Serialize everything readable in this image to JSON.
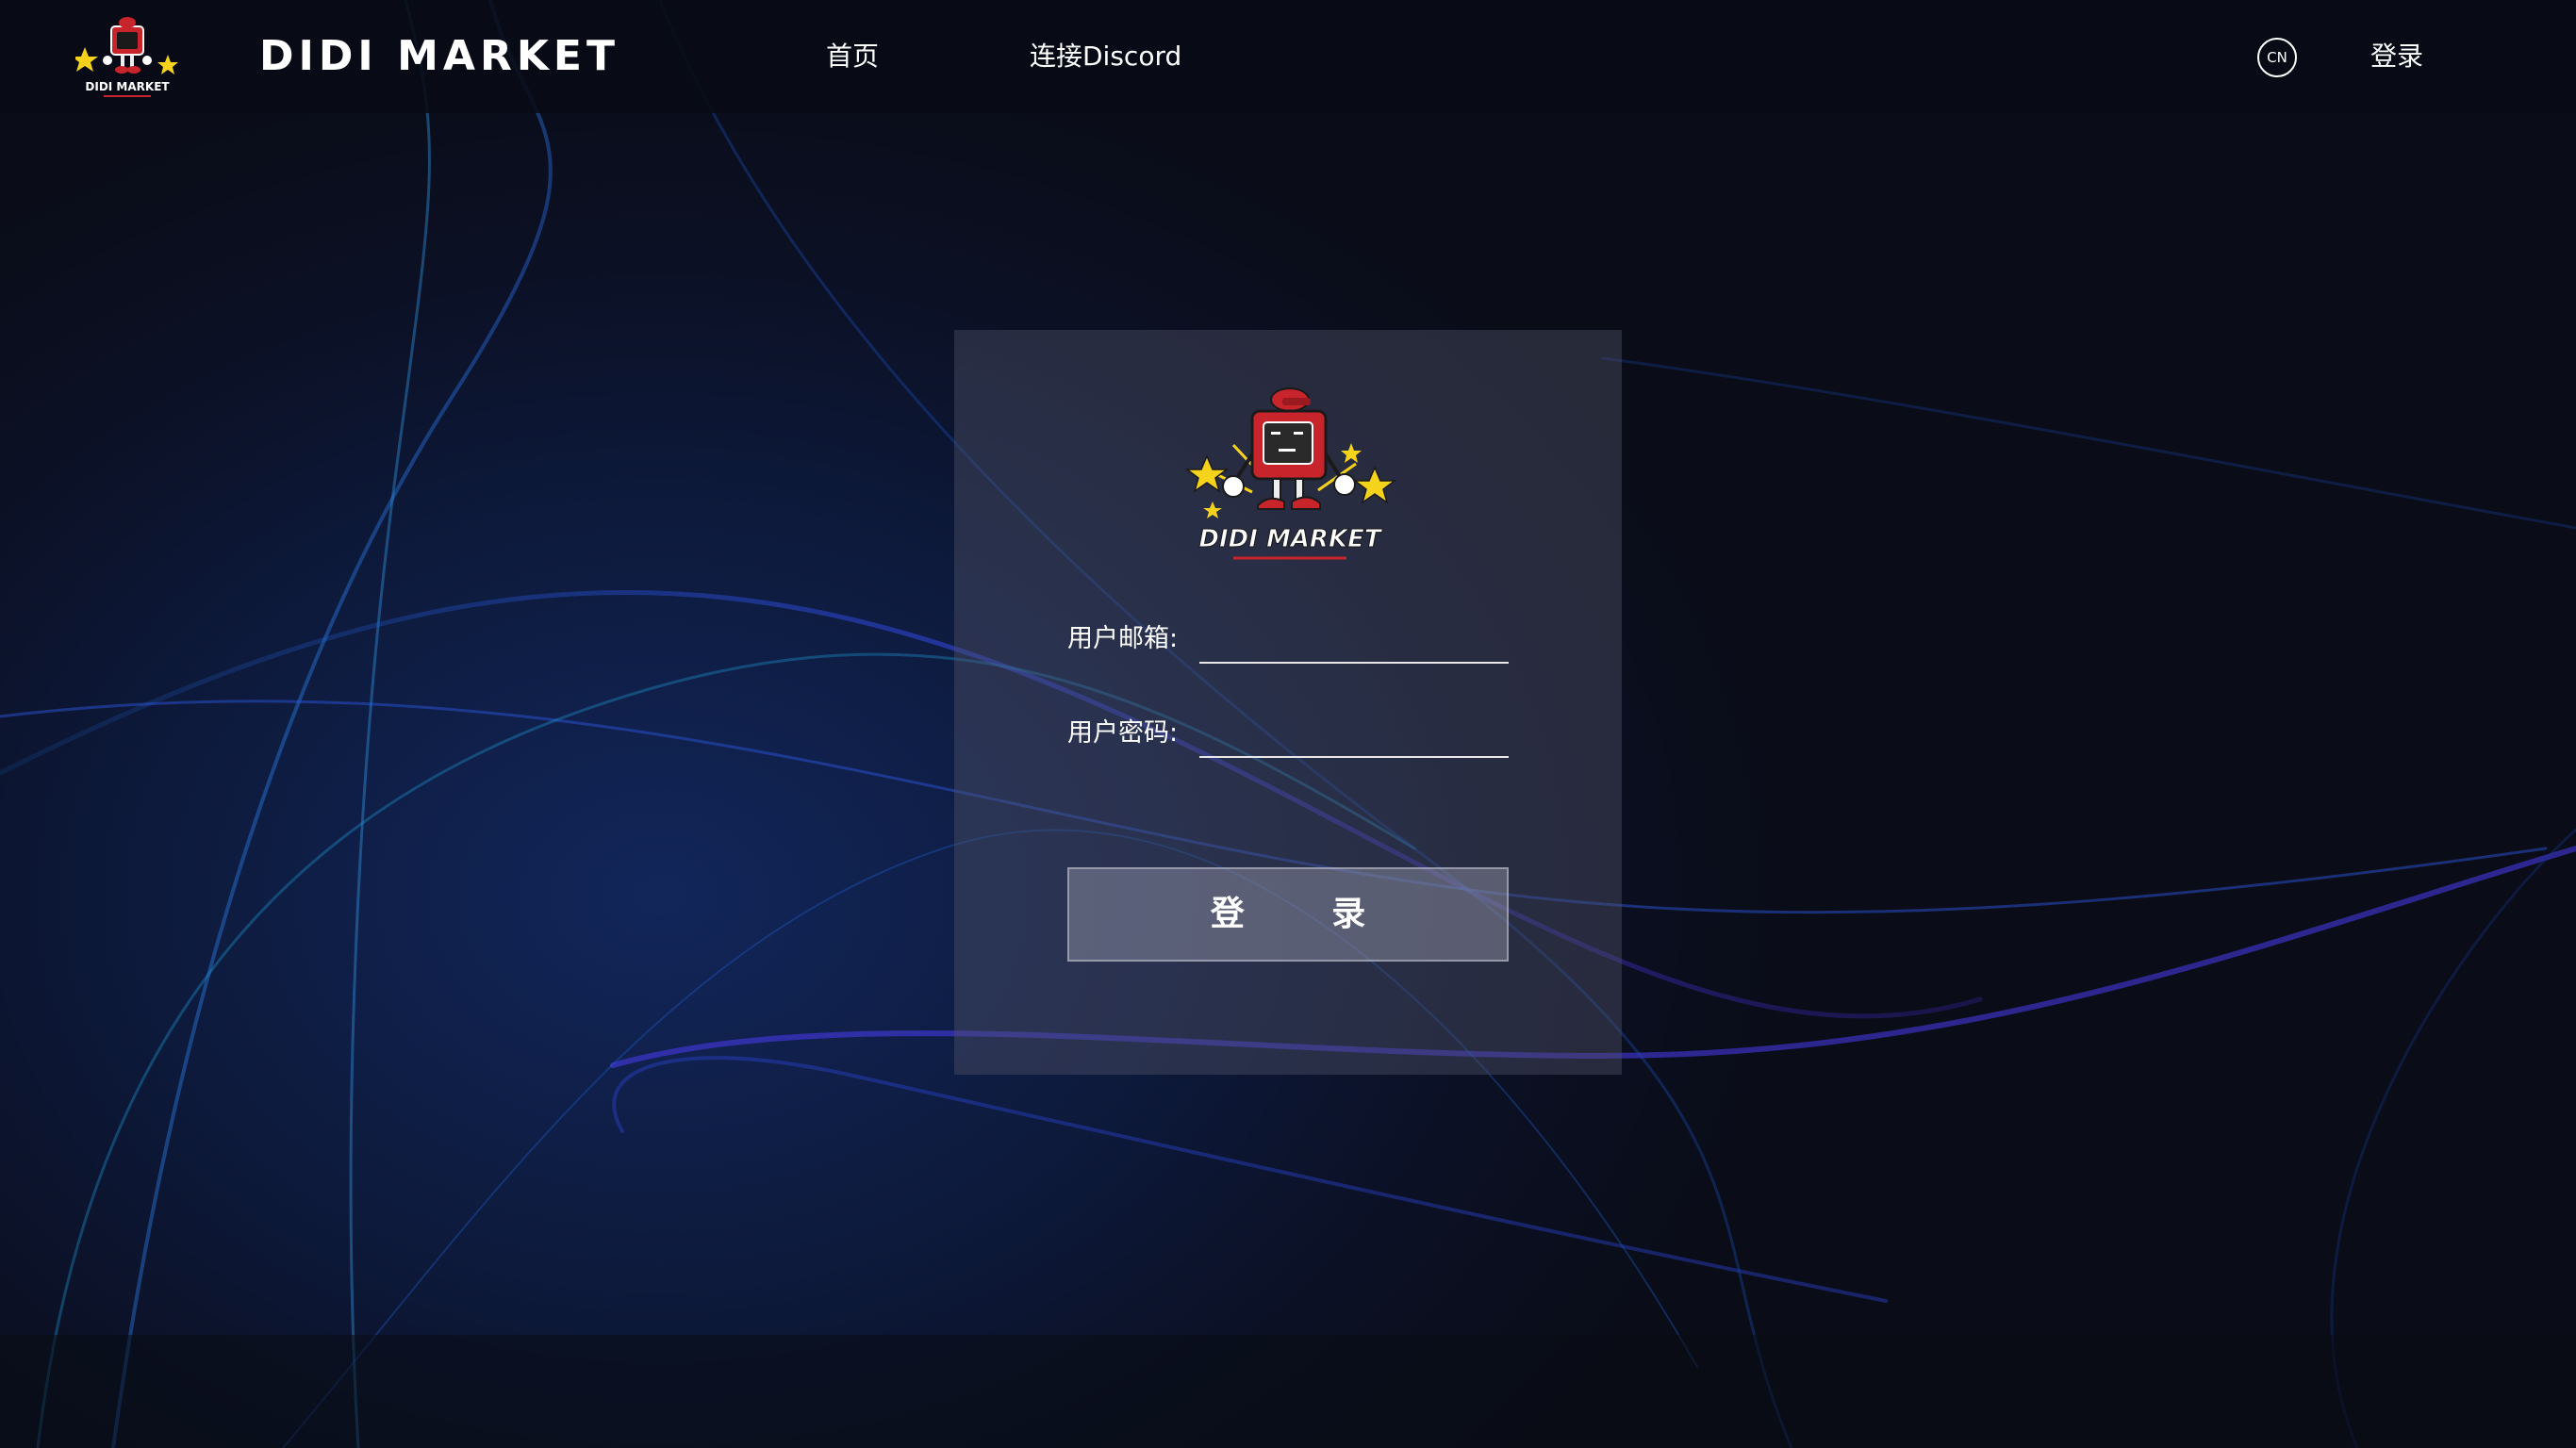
{
  "header": {
    "brand": "DIDI MARKET",
    "logo_icon": "didi-market-mascot-logo",
    "nav": {
      "home": "首页",
      "discord": "连接Discord"
    },
    "language": "CN",
    "login": "登录"
  },
  "login_form": {
    "logo_icon": "didi-market-mascot-logo",
    "logo_text": "DIDI MARKET",
    "email_label": "用户邮箱:",
    "email_value": "",
    "password_label": "用户密码:",
    "password_value": "",
    "submit_label": "登 录"
  },
  "colors": {
    "background": "#0b0f1a",
    "accent_blue": "#2a5cff",
    "accent_teal": "#2bb6d6",
    "mascot_red": "#c8242c",
    "star_yellow": "#f6d31b"
  }
}
